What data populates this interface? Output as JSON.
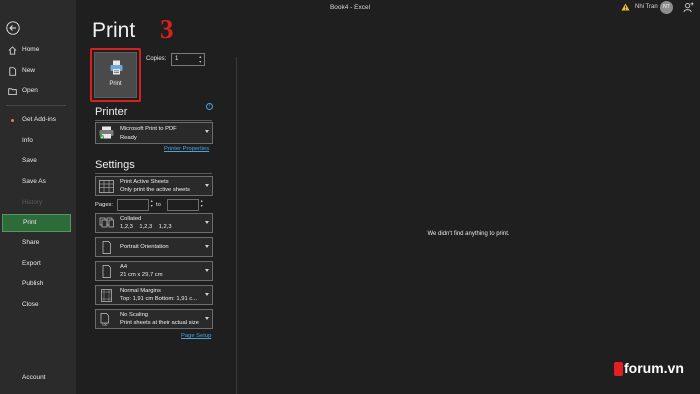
{
  "window": {
    "title": "Book4 - Excel",
    "user_name": "Nhi Tran",
    "user_initials": "NT",
    "warning_icon": "warning-icon",
    "share_icon": "share-person-icon"
  },
  "sidebar": {
    "back_icon": "back-arrow-icon",
    "items": [
      {
        "label": "Home",
        "icon": "home-icon",
        "state": "normal"
      },
      {
        "label": "New",
        "icon": "new-document-icon",
        "state": "normal"
      },
      {
        "label": "Open",
        "icon": "open-folder-icon",
        "state": "normal"
      },
      {
        "label": "Get Add-ins",
        "icon": "dot-indicator",
        "state": "normal"
      },
      {
        "label": "Info",
        "icon": "",
        "state": "normal"
      },
      {
        "label": "Save",
        "icon": "",
        "state": "normal"
      },
      {
        "label": "Save As",
        "icon": "",
        "state": "normal"
      },
      {
        "label": "History",
        "icon": "",
        "state": "disabled"
      },
      {
        "label": "Print",
        "icon": "",
        "state": "active"
      },
      {
        "label": "Share",
        "icon": "",
        "state": "normal"
      },
      {
        "label": "Export",
        "icon": "",
        "state": "normal"
      },
      {
        "label": "Publish",
        "icon": "",
        "state": "normal"
      },
      {
        "label": "Close",
        "icon": "",
        "state": "normal"
      },
      {
        "label": "Account",
        "icon": "",
        "state": "normal"
      }
    ]
  },
  "main": {
    "title": "Print",
    "annotation_number": "3",
    "annotation_color": "#d8201f",
    "print_button": {
      "label": "Print",
      "icon": "printer-icon"
    },
    "copies": {
      "label": "Copies:",
      "value": "1"
    },
    "printer": {
      "heading": "Printer",
      "name": "Microsoft Print to PDF",
      "status": "Ready",
      "properties_link": "Printer Properties",
      "info_icon": "info-icon"
    },
    "settings": {
      "heading": "Settings",
      "what": {
        "line1": "Print Active Sheets",
        "line2": "Only print the active sheets"
      },
      "pages": {
        "label": "Pages:",
        "from": "",
        "to_label": "to",
        "to": ""
      },
      "collation": {
        "line1": "Collated",
        "line2": "1,2,3    1,2,3    1,2,3"
      },
      "orientation": {
        "line1": "Portrait Orientation"
      },
      "paper": {
        "line1": "A4",
        "line2": "21 cm x 29,7 cm"
      },
      "margins": {
        "line1": "Normal Margins",
        "line2": "Top: 1,91 cm Bottom: 1,91 c..."
      },
      "scaling": {
        "line1": "No Scaling",
        "line2": "Print sheets at their actual size"
      },
      "page_setup_link": "Page Setup"
    },
    "preview_message": "We didn't find anything to print."
  },
  "watermark": {
    "text": "forum.vn",
    "accent": "#e31f26"
  },
  "colors": {
    "background": "#1f1f1f",
    "sidebar": "#2b2b2b",
    "active": "#2e6b3a",
    "link": "#4aa3df"
  }
}
